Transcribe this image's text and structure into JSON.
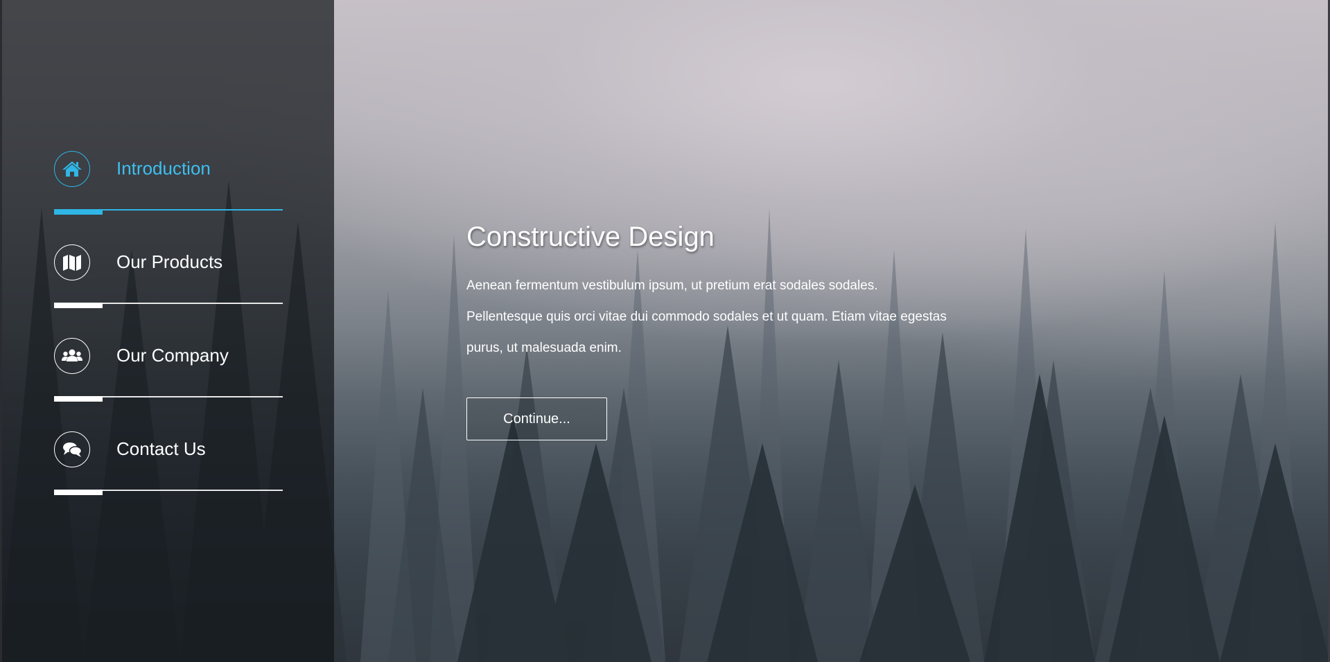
{
  "nav": {
    "items": [
      {
        "label": "Introduction",
        "icon": "home-icon",
        "active": true
      },
      {
        "label": "Our Products",
        "icon": "map-icon",
        "active": false
      },
      {
        "label": "Our Company",
        "icon": "users-icon",
        "active": false
      },
      {
        "label": "Contact Us",
        "icon": "comments-icon",
        "active": false
      }
    ]
  },
  "main": {
    "title": "Constructive Design",
    "body": "Aenean fermentum vestibulum ipsum, ut pretium erat sodales sodales. Pellentesque quis orci vitae dui commodo sodales et ut quam. Etiam vitae egestas purus, ut malesuada enim.",
    "button_label": "Continue..."
  },
  "colors": {
    "accent": "#2fb6e6",
    "panel": "#12161a",
    "text": "#ffffff"
  }
}
